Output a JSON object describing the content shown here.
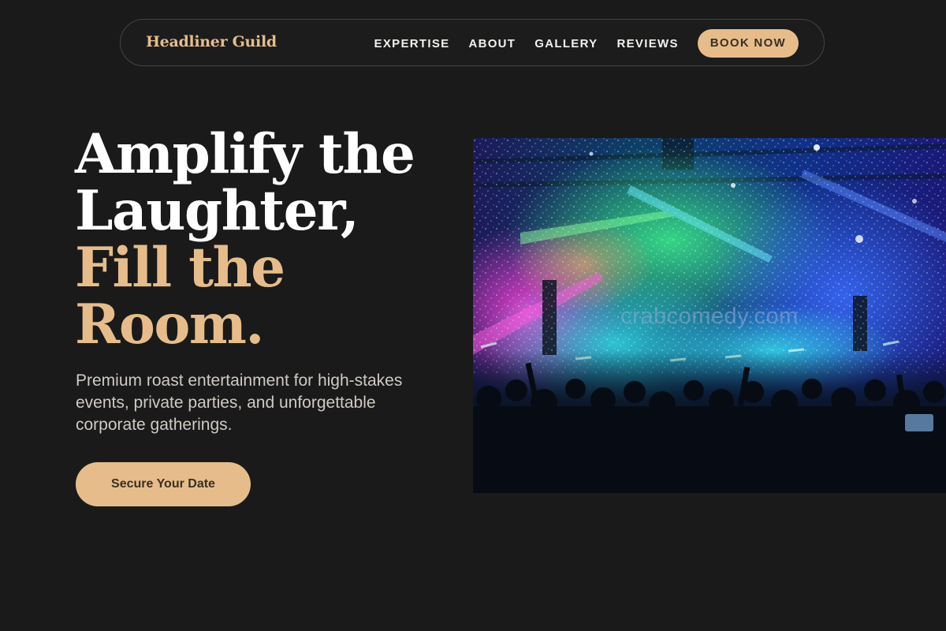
{
  "nav": {
    "brand": "Headliner Guild",
    "links": [
      {
        "label": "EXPERTISE"
      },
      {
        "label": "ABOUT"
      },
      {
        "label": "GALLERY"
      },
      {
        "label": "REVIEWS"
      }
    ],
    "cta_label": "BOOK NOW"
  },
  "hero": {
    "title_line1": "Amplify the",
    "title_line2": "Laughter,",
    "title_accent_line1": "Fill the",
    "title_accent_line2": "Room.",
    "subtitle": "Premium roast entertainment for high-stakes events, private parties, and unforgettable corporate gatherings.",
    "cta_label": "Secure Your Date",
    "image_watermark": "crabcomedy.com"
  },
  "colors": {
    "background": "#1a1a1a",
    "accent": "#e6bd8a",
    "text_primary": "#ffffff",
    "text_secondary": "#cfcac3",
    "nav_border": "#46443f"
  }
}
